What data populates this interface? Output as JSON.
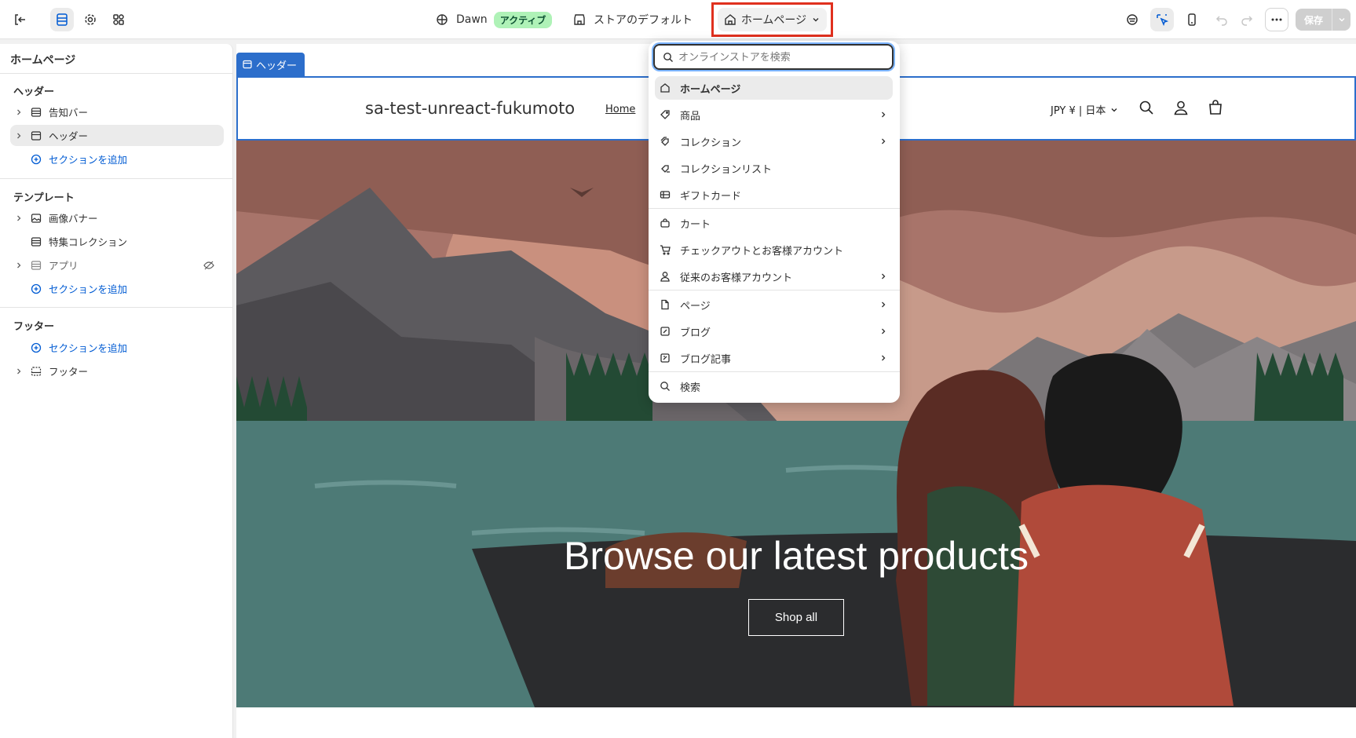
{
  "topbar": {
    "theme_name": "Dawn",
    "theme_status": "アクティブ",
    "store_default": "ストアのデフォルト",
    "page_selector": "ホームページ",
    "save_label": "保存"
  },
  "sidebar": {
    "title": "ホームページ",
    "groups": [
      {
        "heading": "ヘッダー",
        "items": [
          "告知バー",
          "ヘッダー"
        ],
        "add": "セクションを追加"
      },
      {
        "heading": "テンプレート",
        "items": [
          "画像バナー",
          "特集コレクション",
          "アプリ"
        ],
        "add": "セクションを追加"
      },
      {
        "heading": "フッター",
        "add": "セクションを追加",
        "items": [
          "フッター"
        ]
      }
    ]
  },
  "preview": {
    "section_tag": "ヘッダー",
    "store_name": "sa-test-unreact-fukumoto",
    "nav_home": "Home",
    "currency": "JPY ¥ | 日本",
    "hero_title": "Browse our latest products",
    "hero_button": "Shop all"
  },
  "dropdown": {
    "search_placeholder": "オンラインストアを検索",
    "items": [
      "ホームページ",
      "商品",
      "コレクション",
      "コレクションリスト",
      "ギフトカード",
      "カート",
      "チェックアウトとお客様アカウント",
      "従来のお客様アカウント",
      "ページ",
      "ブログ",
      "ブログ記事",
      "検索"
    ]
  },
  "colors": {
    "accent": "#005bd3",
    "highlight": "#e0301e",
    "selection": "#2c6ecb",
    "badge": "#aff2b7"
  }
}
